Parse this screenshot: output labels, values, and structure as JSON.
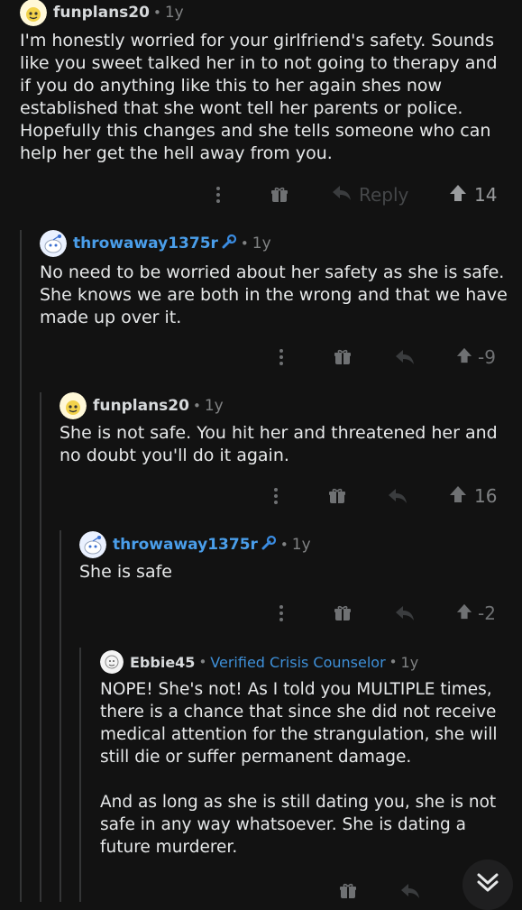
{
  "comments": [
    {
      "user": "funplans20",
      "separator": "•",
      "age": "1y",
      "body": "I'm honestly worried for your girlfriend's safety. Sounds like you sweet talked her in to not going to therapy and if you do anything like this to her again shes now established that she wont tell her parents or police. Hopefully this changes and she tells someone who can help her get the hell away from you.",
      "reply_label": "Reply",
      "votes": "14"
    },
    {
      "user": "throwaway1375r",
      "separator": "•",
      "age": "1y",
      "body": "No need to be worried about her safety as she is safe. She knows we are both in the wrong and that we have made up over it.",
      "votes": "-9"
    },
    {
      "user": "funplans20",
      "separator": "•",
      "age": "1y",
      "body": "She is not safe. You hit her and threatened her and no doubt you'll do it again.",
      "votes": "16"
    },
    {
      "user": "throwaway1375r",
      "separator": "•",
      "age": "1y",
      "body": "She is safe",
      "votes": "-2"
    },
    {
      "user": "Ebbie45",
      "separator": "•",
      "flair": "Verified Crisis Counselor",
      "separator2": "•",
      "age": "1y",
      "body_p1": "NOPE! She's not! As I told you MULTIPLE times, there is a chance that since she did not receive medical attention for the strangulation, she will still die or suffer permanent damage.",
      "body_p2": "And as long as she is still dating you, she is not safe in any way whatsoever. She is dating a future murderer."
    }
  ],
  "icons": {
    "more": "more-options-icon",
    "award": "award-icon",
    "reply": "reply-icon",
    "upvote": "upvote-icon",
    "op": "wrench-mod-icon",
    "jump": "chevron-down-double-icon"
  },
  "colors": {
    "background": "#121212",
    "op_user": "#4a9eea",
    "flair": "#3e90d9",
    "muted": "#818384"
  }
}
